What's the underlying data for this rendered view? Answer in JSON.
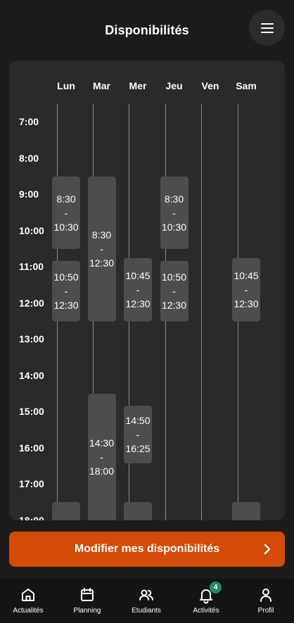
{
  "header": {
    "title": "Disponibilités"
  },
  "calendar": {
    "days": [
      "Lun",
      "Mar",
      "Mer",
      "Jeu",
      "Ven",
      "Sam"
    ],
    "hours": [
      "7:00",
      "8:00",
      "9:00",
      "10:00",
      "11:00",
      "12:00",
      "13:00",
      "14:00",
      "15:00",
      "16:00",
      "17:00",
      "18:00"
    ],
    "slots": [
      {
        "day": "Lun",
        "start": "8:30",
        "end": "10:30"
      },
      {
        "day": "Lun",
        "start": "10:50",
        "end": "12:30"
      },
      {
        "day": "Mar",
        "start": "8:30",
        "end": "12:30"
      },
      {
        "day": "Mar",
        "start": "14:30",
        "end": "18:00"
      },
      {
        "day": "Mer",
        "start": "10:45",
        "end": "12:30"
      },
      {
        "day": "Mer",
        "start": "14:50",
        "end": "16:25"
      },
      {
        "day": "Jeu",
        "start": "8:30",
        "end": "10:30"
      },
      {
        "day": "Jeu",
        "start": "10:50",
        "end": "12:30"
      },
      {
        "day": "Sam",
        "start": "10:45",
        "end": "12:30"
      }
    ]
  },
  "cta": {
    "label": "Modifier mes disponibilités"
  },
  "nav": {
    "items": [
      {
        "label": "Actualités",
        "icon": "home-icon"
      },
      {
        "label": "Planning",
        "icon": "calendar-icon"
      },
      {
        "label": "Etudiants",
        "icon": "users-icon"
      },
      {
        "label": "Activités",
        "icon": "bell-icon",
        "badge": "4"
      },
      {
        "label": "Profil",
        "icon": "user-icon"
      }
    ]
  }
}
